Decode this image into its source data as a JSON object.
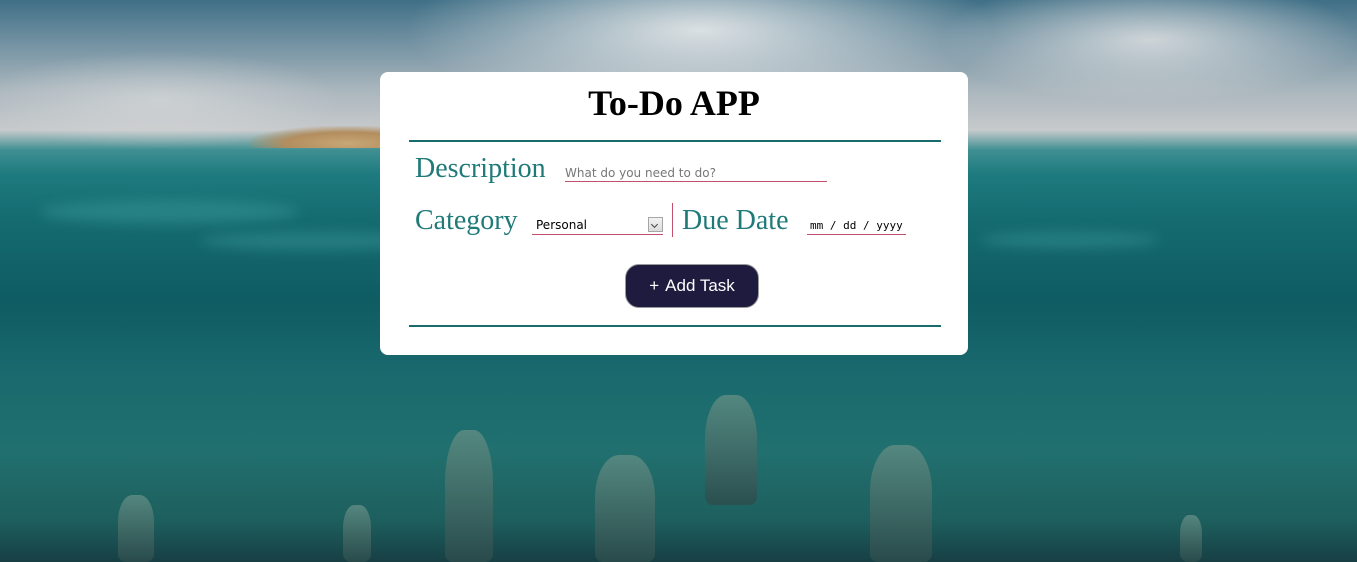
{
  "app": {
    "title": "To-Do APP"
  },
  "form": {
    "description": {
      "label": "Description",
      "placeholder": "What do you need to do?",
      "value": ""
    },
    "category": {
      "label": "Category",
      "selected": "Personal"
    },
    "due_date": {
      "label": "Due Date",
      "value": "mm / dd / yyyy"
    },
    "add_button": {
      "icon": "+",
      "label": "Add Task"
    }
  },
  "colors": {
    "label": "#1f7a78",
    "rule": "#1a6b6b",
    "underline": "#c0506c",
    "button_bg": "#1f1b3e",
    "button_text": "#ffffff",
    "card_bg": "#ffffff"
  }
}
